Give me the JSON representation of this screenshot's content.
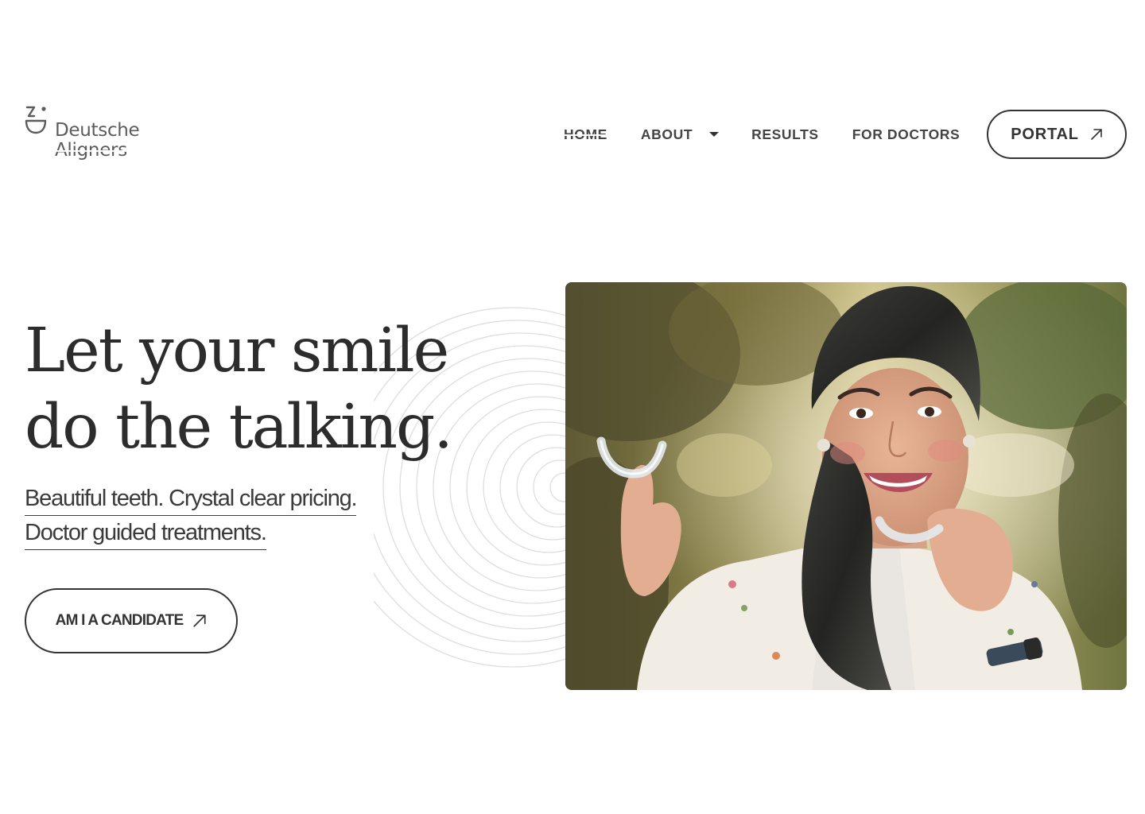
{
  "brand": {
    "name_line1": "Deutsche",
    "name_line2": "Aligners",
    "logo_icon": "smile-logo-icon"
  },
  "nav": {
    "items": [
      {
        "label": "HOME",
        "active": true
      },
      {
        "label": "ABOUT",
        "has_dropdown": true
      },
      {
        "label": "RESULTS"
      },
      {
        "label": "FOR DOCTORS"
      }
    ],
    "portal_label": "PORTAL",
    "portal_icon": "arrow-up-right-icon"
  },
  "hero": {
    "headline_line1": "Let your smile",
    "headline_line2": "do the talking.",
    "subline1": "Beautiful teeth. Crystal clear pricing.",
    "subline2": "Doctor guided treatments.",
    "cta_label": "AM I A CANDIDATE",
    "cta_icon": "arrow-up-right-icon",
    "image_subject": "smiling woman holding clear aligner",
    "background_decoration": "concentric-rings"
  },
  "colors": {
    "text": "#333333",
    "background": "#ffffff",
    "ring": "#dedede"
  }
}
